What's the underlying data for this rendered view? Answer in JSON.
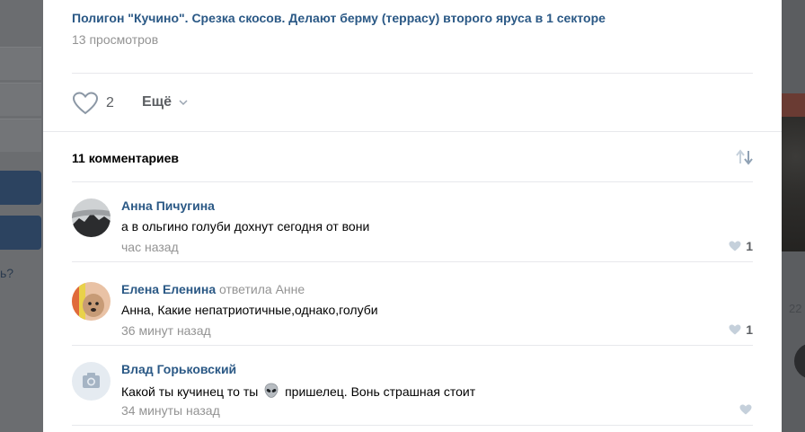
{
  "backdrop": {
    "left_fragment": "ь?",
    "right_number": "22"
  },
  "post": {
    "title": "Полигон \"Кучино\". Срезка скосов. Делают берму (террасу) второго яруса в 1 секторе",
    "views": "13 просмотров",
    "likes": "2",
    "more_label": "Ещё"
  },
  "comments_header": {
    "count_label": "11 комментариев"
  },
  "comments": [
    {
      "author": "Анна Пичугина",
      "reply_to": "",
      "text": "а в ольгино голуби дохнут сегодня от вони",
      "time": "час назад",
      "likes": "1"
    },
    {
      "author": "Елена Еленина",
      "reply_to": "ответила Анне",
      "text": "Анна, Какие непатриотичные,однако,голуби",
      "time": "36 минут назад",
      "likes": "1"
    },
    {
      "author": "Влад Горьковский",
      "reply_to": "",
      "text_before": "Какой ты кучинец то ты",
      "emoji": "alien-face",
      "text_after": "пришелец. Вонь страшная стоит",
      "time": "34 минуты назад",
      "likes": ""
    }
  ],
  "colors": {
    "link": "#2a5885",
    "muted": "#939393",
    "icon": "#c5d0db",
    "divider": "#e7e8ec"
  }
}
